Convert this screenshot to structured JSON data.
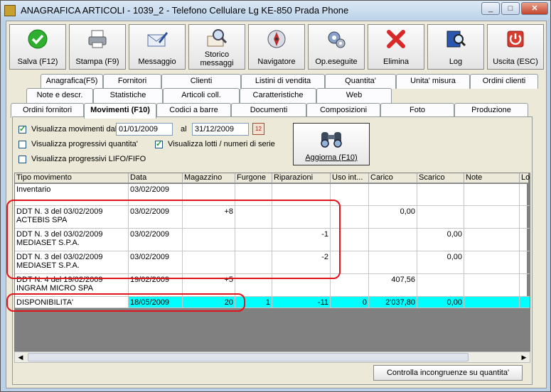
{
  "window": {
    "title": "ANAGRAFICA ARTICOLI - 1039_2 - Telefono Cellulare Lg KE-850 Prada Phone",
    "min": "_",
    "max": "□",
    "close": "✕"
  },
  "toolbar": [
    {
      "label": "Salva (F12)",
      "icon": "check-icon"
    },
    {
      "label": "Stampa (F9)",
      "icon": "printer-icon"
    },
    {
      "label": "Messaggio",
      "icon": "envelope-pen-icon"
    },
    {
      "label": "Storico messaggi",
      "icon": "envelope-search-icon"
    },
    {
      "label": "Navigatore",
      "icon": "compass-icon"
    },
    {
      "label": "Op.eseguite",
      "icon": "gears-icon"
    },
    {
      "label": "Elimina",
      "icon": "red-x-icon"
    },
    {
      "label": "Log",
      "icon": "book-search-icon"
    },
    {
      "label": "Uscita (ESC)",
      "icon": "power-icon"
    }
  ],
  "tabs_row1": [
    "Anagrafica(F5)",
    "Fornitori",
    "Clienti",
    "Listini di vendita",
    "Quantita'",
    "Unita' misura",
    "Ordini clienti"
  ],
  "tabs_row2": [
    "Note e descr.",
    "Statistiche",
    "Articoli coll.",
    "Caratteristiche",
    "Web"
  ],
  "tabs_row3": [
    "Ordini fornitori",
    "Movimenti (F10)",
    "Codici a barre",
    "Documenti",
    "Composizioni",
    "Foto",
    "Produzione"
  ],
  "filters": {
    "show_movements": {
      "label": "Visualizza movimenti dal",
      "checked": true
    },
    "date_from": "01/01/2009",
    "al": "al",
    "date_to": "31/12/2009",
    "progressive_qty": {
      "label": "Visualizza progressivi quantita'",
      "checked": false
    },
    "show_lots": {
      "label": "Visualizza lotti /  numeri di serie",
      "checked": true
    },
    "progressive_lifo": {
      "label": "Visualizza progressivi LIFO/FIFO",
      "checked": false
    },
    "refresh_label": "Aggiorna (F10)"
  },
  "grid": {
    "columns": [
      "Tipo movimento",
      "Data",
      "Magazzino",
      "Furgone",
      "Riparazioni",
      "Uso int...",
      "Carico",
      "Scarico",
      "Note",
      "Lo"
    ],
    "rows": [
      {
        "c": [
          "Inventario",
          "03/02/2009",
          "",
          "",
          "",
          "",
          "",
          "",
          "",
          ""
        ]
      },
      {
        "c": [
          "DDT N. 3 del 03/02/2009\nACTEBIS SPA",
          "03/02/2009",
          "+8",
          "",
          "",
          "",
          "0,00",
          "",
          "",
          ""
        ]
      },
      {
        "c": [
          "DDT N. 3 del 03/02/2009\nMEDIASET S.P.A.",
          "03/02/2009",
          "",
          "",
          "-1",
          "",
          "",
          "0,00",
          "",
          ""
        ]
      },
      {
        "c": [
          "DDT N. 3 del 03/02/2009\nMEDIASET S.P.A.",
          "03/02/2009",
          "",
          "",
          "-2",
          "",
          "",
          "0,00",
          "",
          ""
        ]
      },
      {
        "c": [
          "DDT N. 4 del 19/02/2009\nINGRAM MICRO SPA",
          "19/02/2009",
          "+5",
          "",
          "",
          "",
          "407,56",
          "",
          "",
          ""
        ]
      },
      {
        "c": [
          "DISPONIBILITA'",
          "18/05/2009",
          "20",
          "1",
          "-11",
          "0",
          "2'037,80",
          "0,00",
          "",
          ""
        ]
      }
    ]
  },
  "check_button": "Controlla incongruenze su quantita'",
  "colors": {
    "highlight": "#00ffff",
    "annotation": "#e0141b"
  }
}
